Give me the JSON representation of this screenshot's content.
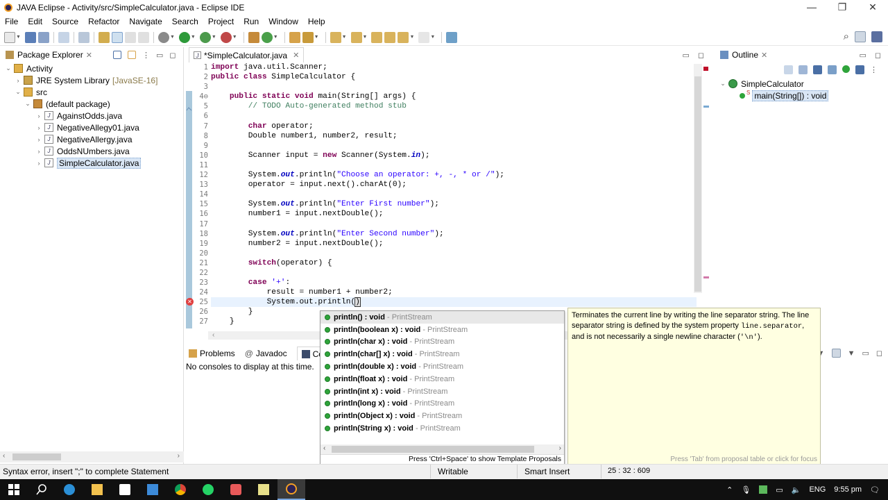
{
  "window": {
    "title": "JAVA Eclipse - Activity/src/SimpleCalculator.java - Eclipse IDE",
    "min": "—",
    "max": "❐",
    "close": "✕"
  },
  "menu": [
    "File",
    "Edit",
    "Source",
    "Refactor",
    "Navigate",
    "Search",
    "Project",
    "Run",
    "Window",
    "Help"
  ],
  "package_explorer": {
    "title": "Package Explorer",
    "project": "Activity",
    "jre": "JRE System Library",
    "jre_version": "[JavaSE-16]",
    "src": "src",
    "pkg": "(default package)",
    "files": [
      "AgainstOdds.java",
      "NegativeAllegy01.java",
      "NegativeAllergy.java",
      "OddsNUmbers.java",
      "SimpleCalculator.java"
    ]
  },
  "editor": {
    "tab": "*SimpleCalculator.java",
    "line_numbers": [
      "1",
      "2",
      "3",
      "4⊖",
      "5",
      "6",
      "7",
      "8",
      "9",
      "10",
      "11",
      "12",
      "13",
      "14",
      "15",
      "16",
      "17",
      "18",
      "19",
      "20",
      "21",
      "22",
      "23",
      "24",
      "25",
      "26",
      "27"
    ]
  },
  "outline": {
    "title": "Outline",
    "class": "SimpleCalculator",
    "method": "main(String[]) : void",
    "static_mark": "S"
  },
  "bottom": {
    "tabs": [
      "Problems",
      "Javadoc",
      "Conso"
    ],
    "message": "No consoles to display at this time."
  },
  "proposals": {
    "items": [
      {
        "name": "println() : void",
        "cls": "PrintStream"
      },
      {
        "name": "println(boolean x) : void",
        "cls": "PrintStream"
      },
      {
        "name": "println(char x) : void",
        "cls": "PrintStream"
      },
      {
        "name": "println(char[] x) : void",
        "cls": "PrintStream"
      },
      {
        "name": "println(double x) : void",
        "cls": "PrintStream"
      },
      {
        "name": "println(float x) : void",
        "cls": "PrintStream"
      },
      {
        "name": "println(int x) : void",
        "cls": "PrintStream"
      },
      {
        "name": "println(long x) : void",
        "cls": "PrintStream"
      },
      {
        "name": "println(Object x) : void",
        "cls": "PrintStream"
      },
      {
        "name": "println(String x) : void",
        "cls": "PrintStream"
      }
    ],
    "footer": "Press 'Ctrl+Space' to show Template Proposals"
  },
  "doc": {
    "text1": "Terminates the current line by writing the line separator string. The line separator string is defined by the system property ",
    "code1": "line.separator",
    "text2": ", and is not necessarily a single newline character (",
    "code2": "'\\n'",
    "text3": ").",
    "hint": "Press 'Tab' from proposal table or click for focus"
  },
  "status": {
    "error": "Syntax error, insert \";\" to complete Statement",
    "mode": "Writable",
    "insert": "Smart Insert",
    "pos": "25 : 32 : 609"
  },
  "taskbar": {
    "lang": "ENG",
    "time": "9:55 pm"
  }
}
